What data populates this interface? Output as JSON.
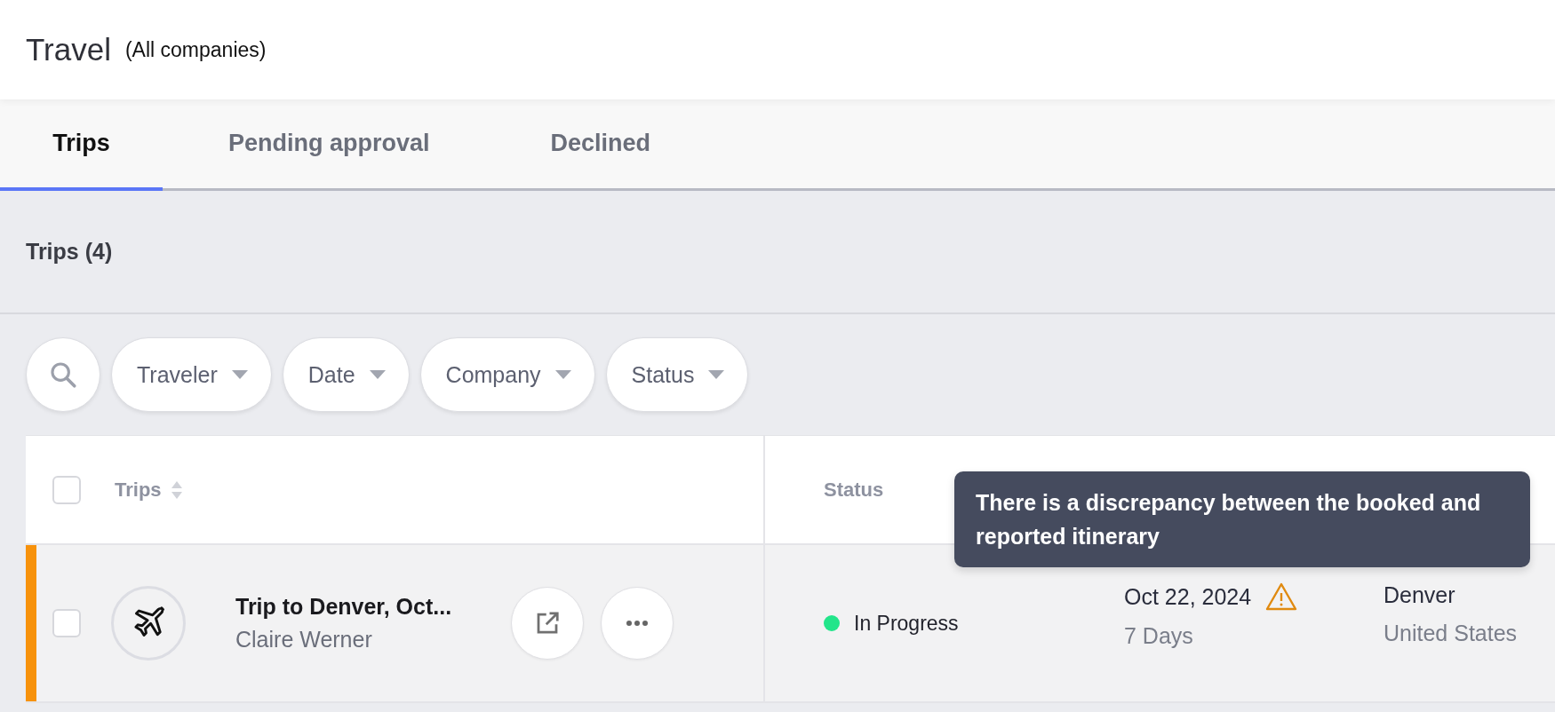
{
  "header": {
    "title": "Travel",
    "subtitle": "(All companies)"
  },
  "tabs": [
    {
      "label": "Trips",
      "selected": true
    },
    {
      "label": "Pending approval",
      "selected": false
    },
    {
      "label": "Declined",
      "selected": false
    }
  ],
  "section": {
    "title": "Trips (4)"
  },
  "filters": [
    "Traveler",
    "Date",
    "Company",
    "Status"
  ],
  "table": {
    "select_all": {
      "checked": false
    },
    "columns": [
      "Trips",
      "Status"
    ],
    "rows": [
      {
        "flagged": true,
        "checked": false,
        "title": "Trip to Denver, Oct...",
        "traveler": "Claire Werner",
        "status": "In Progress",
        "color": "#22e58a",
        "date": "Oct 22, 2024",
        "warning": true,
        "duration": "7 Days",
        "city": "Denver",
        "country": "United States"
      }
    ]
  },
  "tooltip": {
    "text": "There is a discrepancy between the booked and reported itinerary"
  }
}
